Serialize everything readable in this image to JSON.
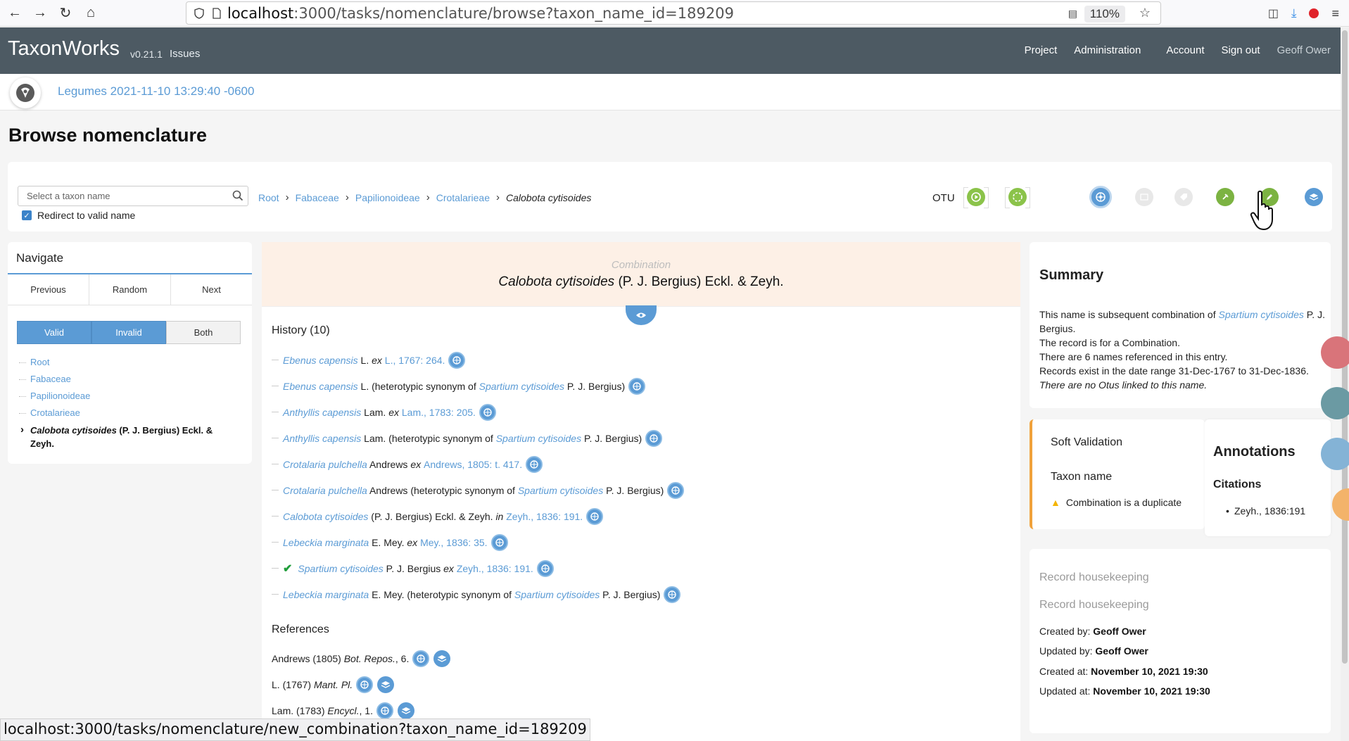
{
  "browser": {
    "url_host": "localhost",
    "url_rest": ":3000/tasks/nomenclature/browse?taxon_name_id=189209",
    "zoom": "110%",
    "status_url": "localhost:3000/tasks/nomenclature/new_combination?taxon_name_id=189209"
  },
  "app": {
    "brand": "TaxonWorks",
    "version": "v0.21.1",
    "issues": "Issues",
    "nav": [
      "Project",
      "Administration",
      "Account",
      "Sign out"
    ],
    "user": "Geoff Ower",
    "project": "Legumes 2021-11-10 13:29:40 -0600"
  },
  "page": {
    "title": "Browse nomenclature"
  },
  "search": {
    "placeholder": "Select a taxon name",
    "redirect_label": "Redirect to valid name",
    "otu_label": "OTU"
  },
  "breadcrumb": [
    "Root",
    "Fabaceae",
    "Papilionoideae",
    "Crotalarieae"
  ],
  "breadcrumb_current": "Calobota cytisoides",
  "navigate": {
    "title": "Navigate",
    "buttons": [
      "Previous",
      "Random",
      "Next"
    ],
    "toggles": [
      "Valid",
      "Invalid",
      "Both"
    ],
    "tree": [
      "Root",
      "Fabaceae",
      "Papilionoideae",
      "Crotalarieae"
    ],
    "current_name": "Calobota cytisoides",
    "current_author": " (P. J. Bergius) Eckl. & Zeyh."
  },
  "main": {
    "kind": "Combination",
    "name": "Calobota cytisoides",
    "author": " (P. J. Bergius) Eckl. & Zeyh.",
    "history_title": "History (10)",
    "references_title": "References"
  },
  "history": [
    {
      "name": "Ebenus capensis",
      "author": " L. ",
      "mid": "ex ",
      "cite": "L., 1767: 264.",
      "after": ""
    },
    {
      "name": "Ebenus capensis",
      "author": " L. (heterotypic synonym of ",
      "syn": "Spartium cytisoides",
      "after": " P. J. Bergius)"
    },
    {
      "name": "Anthyllis capensis",
      "author": " Lam. ",
      "mid": "ex ",
      "cite": "Lam., 1783: 205.",
      "after": ""
    },
    {
      "name": "Anthyllis capensis",
      "author": " Lam. (heterotypic synonym of ",
      "syn": "Spartium cytisoides",
      "after": " P. J. Bergius)"
    },
    {
      "name": "Crotalaria pulchella",
      "author": " Andrews ",
      "mid": "ex ",
      "cite": "Andrews, 1805: t. 417.",
      "after": ""
    },
    {
      "name": "Crotalaria pulchella",
      "author": " Andrews (heterotypic synonym of ",
      "syn": "Spartium cytisoides",
      "after": " P. J. Bergius)"
    },
    {
      "name": "Calobota cytisoides",
      "author": " (P. J. Bergius) Eckl. & Zeyh. ",
      "mid": "in ",
      "cite": "Zeyh., 1836: 191.",
      "after": ""
    },
    {
      "name": "Lebeckia marginata",
      "author": " E. Mey. ",
      "mid": "ex ",
      "cite": "Mey., 1836: 35.",
      "after": ""
    },
    {
      "name": "Spartium cytisoides",
      "author": " P. J. Bergius ",
      "mid": "ex ",
      "cite": "Zeyh., 1836: 191.",
      "after": "",
      "valid": true
    },
    {
      "name": "Lebeckia marginata",
      "author": " E. Mey. (heterotypic synonym of ",
      "syn": "Spartium cytisoides",
      "after": " P. J. Bergius)"
    }
  ],
  "references": [
    {
      "author": "Andrews (1805) ",
      "journal": "Bot. Repos.",
      "rest": ", 6."
    },
    {
      "author": "L. (1767) ",
      "journal": "Mant. Pl.",
      "rest": ""
    },
    {
      "author": "Lam. (1783) ",
      "journal": "Encycl.",
      "rest": ", 1."
    }
  ],
  "summary": {
    "title": "Summary",
    "line1_pre": "This name is subsequent combination of ",
    "line1_link": "Spartium cytisoides",
    "line1_post": " P. J. Bergius.",
    "line2": "The record is for a Combination.",
    "line3": "There are 6 names referenced in this entry.",
    "line4": "Records exist in the date range 31-Dec-1767 to 31-Dec-1836.",
    "line5": "There are no Otus linked to this name."
  },
  "soft_validation": {
    "title": "Soft Validation",
    "section": "Taxon name",
    "message": "Combination is a duplicate"
  },
  "annotations": {
    "title": "Annotations",
    "citations_label": "Citations",
    "citation": "Zeyh., 1836:191"
  },
  "housekeeping": {
    "title1": "Record housekeeping",
    "title2": "Record housekeeping",
    "created_by_label": "Created by: ",
    "created_by": "Geoff Ower",
    "updated_by_label": "Updated by: ",
    "updated_by": "Geoff Ower",
    "created_at_label": "Created at: ",
    "created_at": "November 10, 2021 19:30",
    "updated_at_label": "Updated at: ",
    "updated_at": "November 10, 2021 19:30"
  },
  "colors": {
    "header": "#4d5a63",
    "link": "#5b9bd5",
    "accent_green": "#7cb342",
    "warning": "#f0a13a"
  }
}
